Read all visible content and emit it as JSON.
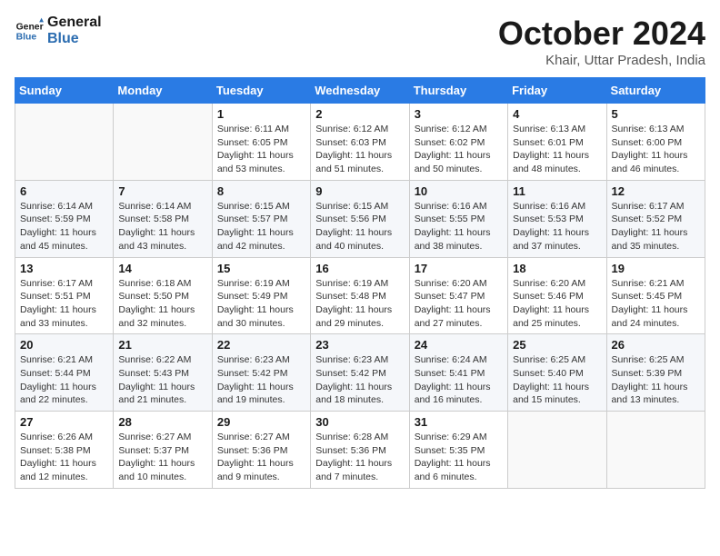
{
  "logo": {
    "line1": "General",
    "line2": "Blue"
  },
  "title": "October 2024",
  "location": "Khair, Uttar Pradesh, India",
  "weekdays": [
    "Sunday",
    "Monday",
    "Tuesday",
    "Wednesday",
    "Thursday",
    "Friday",
    "Saturday"
  ],
  "weeks": [
    [
      {
        "day": "",
        "info": ""
      },
      {
        "day": "",
        "info": ""
      },
      {
        "day": "1",
        "info": "Sunrise: 6:11 AM\nSunset: 6:05 PM\nDaylight: 11 hours and 53 minutes."
      },
      {
        "day": "2",
        "info": "Sunrise: 6:12 AM\nSunset: 6:03 PM\nDaylight: 11 hours and 51 minutes."
      },
      {
        "day": "3",
        "info": "Sunrise: 6:12 AM\nSunset: 6:02 PM\nDaylight: 11 hours and 50 minutes."
      },
      {
        "day": "4",
        "info": "Sunrise: 6:13 AM\nSunset: 6:01 PM\nDaylight: 11 hours and 48 minutes."
      },
      {
        "day": "5",
        "info": "Sunrise: 6:13 AM\nSunset: 6:00 PM\nDaylight: 11 hours and 46 minutes."
      }
    ],
    [
      {
        "day": "6",
        "info": "Sunrise: 6:14 AM\nSunset: 5:59 PM\nDaylight: 11 hours and 45 minutes."
      },
      {
        "day": "7",
        "info": "Sunrise: 6:14 AM\nSunset: 5:58 PM\nDaylight: 11 hours and 43 minutes."
      },
      {
        "day": "8",
        "info": "Sunrise: 6:15 AM\nSunset: 5:57 PM\nDaylight: 11 hours and 42 minutes."
      },
      {
        "day": "9",
        "info": "Sunrise: 6:15 AM\nSunset: 5:56 PM\nDaylight: 11 hours and 40 minutes."
      },
      {
        "day": "10",
        "info": "Sunrise: 6:16 AM\nSunset: 5:55 PM\nDaylight: 11 hours and 38 minutes."
      },
      {
        "day": "11",
        "info": "Sunrise: 6:16 AM\nSunset: 5:53 PM\nDaylight: 11 hours and 37 minutes."
      },
      {
        "day": "12",
        "info": "Sunrise: 6:17 AM\nSunset: 5:52 PM\nDaylight: 11 hours and 35 minutes."
      }
    ],
    [
      {
        "day": "13",
        "info": "Sunrise: 6:17 AM\nSunset: 5:51 PM\nDaylight: 11 hours and 33 minutes."
      },
      {
        "day": "14",
        "info": "Sunrise: 6:18 AM\nSunset: 5:50 PM\nDaylight: 11 hours and 32 minutes."
      },
      {
        "day": "15",
        "info": "Sunrise: 6:19 AM\nSunset: 5:49 PM\nDaylight: 11 hours and 30 minutes."
      },
      {
        "day": "16",
        "info": "Sunrise: 6:19 AM\nSunset: 5:48 PM\nDaylight: 11 hours and 29 minutes."
      },
      {
        "day": "17",
        "info": "Sunrise: 6:20 AM\nSunset: 5:47 PM\nDaylight: 11 hours and 27 minutes."
      },
      {
        "day": "18",
        "info": "Sunrise: 6:20 AM\nSunset: 5:46 PM\nDaylight: 11 hours and 25 minutes."
      },
      {
        "day": "19",
        "info": "Sunrise: 6:21 AM\nSunset: 5:45 PM\nDaylight: 11 hours and 24 minutes."
      }
    ],
    [
      {
        "day": "20",
        "info": "Sunrise: 6:21 AM\nSunset: 5:44 PM\nDaylight: 11 hours and 22 minutes."
      },
      {
        "day": "21",
        "info": "Sunrise: 6:22 AM\nSunset: 5:43 PM\nDaylight: 11 hours and 21 minutes."
      },
      {
        "day": "22",
        "info": "Sunrise: 6:23 AM\nSunset: 5:42 PM\nDaylight: 11 hours and 19 minutes."
      },
      {
        "day": "23",
        "info": "Sunrise: 6:23 AM\nSunset: 5:42 PM\nDaylight: 11 hours and 18 minutes."
      },
      {
        "day": "24",
        "info": "Sunrise: 6:24 AM\nSunset: 5:41 PM\nDaylight: 11 hours and 16 minutes."
      },
      {
        "day": "25",
        "info": "Sunrise: 6:25 AM\nSunset: 5:40 PM\nDaylight: 11 hours and 15 minutes."
      },
      {
        "day": "26",
        "info": "Sunrise: 6:25 AM\nSunset: 5:39 PM\nDaylight: 11 hours and 13 minutes."
      }
    ],
    [
      {
        "day": "27",
        "info": "Sunrise: 6:26 AM\nSunset: 5:38 PM\nDaylight: 11 hours and 12 minutes."
      },
      {
        "day": "28",
        "info": "Sunrise: 6:27 AM\nSunset: 5:37 PM\nDaylight: 11 hours and 10 minutes."
      },
      {
        "day": "29",
        "info": "Sunrise: 6:27 AM\nSunset: 5:36 PM\nDaylight: 11 hours and 9 minutes."
      },
      {
        "day": "30",
        "info": "Sunrise: 6:28 AM\nSunset: 5:36 PM\nDaylight: 11 hours and 7 minutes."
      },
      {
        "day": "31",
        "info": "Sunrise: 6:29 AM\nSunset: 5:35 PM\nDaylight: 11 hours and 6 minutes."
      },
      {
        "day": "",
        "info": ""
      },
      {
        "day": "",
        "info": ""
      }
    ]
  ]
}
